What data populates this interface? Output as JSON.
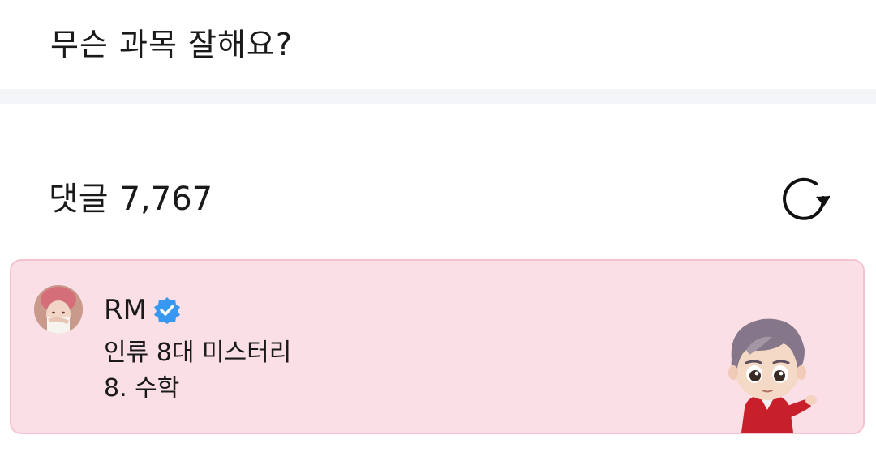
{
  "post": {
    "title": "무슨 과목 잘해요?"
  },
  "comments_section": {
    "label": "댓글",
    "count": "7,767",
    "refresh_icon": "refresh-icon"
  },
  "comment": {
    "author": "RM",
    "verified_icon": "verified-badge-icon",
    "lines": [
      "인류 8대 미스터리",
      "8. 수학"
    ],
    "card_bg": "#fbdfe6",
    "verified_color": "#3897f0"
  }
}
